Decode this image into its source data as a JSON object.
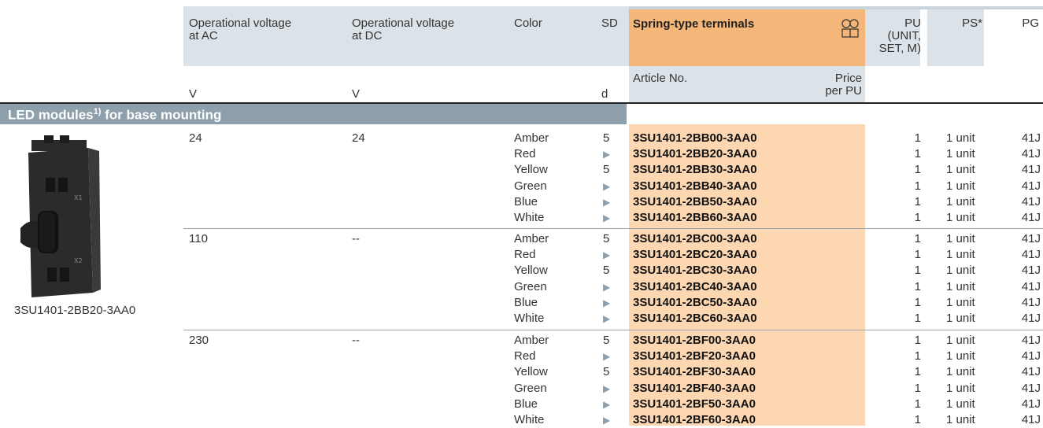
{
  "header": {
    "col_ac": [
      "Operational voltage",
      "at AC"
    ],
    "col_dc": [
      "Operational voltage",
      "at DC"
    ],
    "col_color": "Color",
    "col_sd": "SD",
    "col_terminals": "Spring-type terminals",
    "col_pu": [
      "PU",
      "(UNIT,",
      "SET, M)"
    ],
    "col_ps": "PS*",
    "col_pg": "PG",
    "unit_ac": "V",
    "unit_dc": "V",
    "unit_sd": "d",
    "col_article": "Article No.",
    "col_price": [
      "Price",
      "per PU"
    ]
  },
  "section": {
    "title": "LED modules",
    "sup": "1)",
    "title_suffix": " for base mounting"
  },
  "product": {
    "caption": "3SU1401-2BB20-3AA0",
    "mark_x1": "X1",
    "mark_x2": "X2"
  },
  "groups": [
    {
      "ac": "24",
      "dc": "24",
      "rows": [
        {
          "color": "Amber",
          "sd": "5",
          "article": "3SU1401-2BB00-3AA0",
          "pu": "1",
          "ps": "1 unit",
          "pg": "41J"
        },
        {
          "color": "Red",
          "sd": "▶",
          "article": "3SU1401-2BB20-3AA0",
          "pu": "1",
          "ps": "1 unit",
          "pg": "41J"
        },
        {
          "color": "Yellow",
          "sd": "5",
          "article": "3SU1401-2BB30-3AA0",
          "pu": "1",
          "ps": "1 unit",
          "pg": "41J"
        },
        {
          "color": "Green",
          "sd": "▶",
          "article": "3SU1401-2BB40-3AA0",
          "pu": "1",
          "ps": "1 unit",
          "pg": "41J"
        },
        {
          "color": "Blue",
          "sd": "▶",
          "article": "3SU1401-2BB50-3AA0",
          "pu": "1",
          "ps": "1 unit",
          "pg": "41J"
        },
        {
          "color": "White",
          "sd": "▶",
          "article": "3SU1401-2BB60-3AA0",
          "pu": "1",
          "ps": "1 unit",
          "pg": "41J"
        }
      ]
    },
    {
      "ac": "110",
      "dc": "--",
      "rows": [
        {
          "color": "Amber",
          "sd": "5",
          "article": "3SU1401-2BC00-3AA0",
          "pu": "1",
          "ps": "1 unit",
          "pg": "41J"
        },
        {
          "color": "Red",
          "sd": "▶",
          "article": "3SU1401-2BC20-3AA0",
          "pu": "1",
          "ps": "1 unit",
          "pg": "41J"
        },
        {
          "color": "Yellow",
          "sd": "5",
          "article": "3SU1401-2BC30-3AA0",
          "pu": "1",
          "ps": "1 unit",
          "pg": "41J"
        },
        {
          "color": "Green",
          "sd": "▶",
          "article": "3SU1401-2BC40-3AA0",
          "pu": "1",
          "ps": "1 unit",
          "pg": "41J"
        },
        {
          "color": "Blue",
          "sd": "▶",
          "article": "3SU1401-2BC50-3AA0",
          "pu": "1",
          "ps": "1 unit",
          "pg": "41J"
        },
        {
          "color": "White",
          "sd": "▶",
          "article": "3SU1401-2BC60-3AA0",
          "pu": "1",
          "ps": "1 unit",
          "pg": "41J"
        }
      ]
    },
    {
      "ac": "230",
      "dc": "--",
      "rows": [
        {
          "color": "Amber",
          "sd": "5",
          "article": "3SU1401-2BF00-3AA0",
          "pu": "1",
          "ps": "1 unit",
          "pg": "41J"
        },
        {
          "color": "Red",
          "sd": "▶",
          "article": "3SU1401-2BF20-3AA0",
          "pu": "1",
          "ps": "1 unit",
          "pg": "41J"
        },
        {
          "color": "Yellow",
          "sd": "5",
          "article": "3SU1401-2BF30-3AA0",
          "pu": "1",
          "ps": "1 unit",
          "pg": "41J"
        },
        {
          "color": "Green",
          "sd": "▶",
          "article": "3SU1401-2BF40-3AA0",
          "pu": "1",
          "ps": "1 unit",
          "pg": "41J"
        },
        {
          "color": "Blue",
          "sd": "▶",
          "article": "3SU1401-2BF50-3AA0",
          "pu": "1",
          "ps": "1 unit",
          "pg": "41J"
        },
        {
          "color": "White",
          "sd": "▶",
          "article": "3SU1401-2BF60-3AA0",
          "pu": "1",
          "ps": "1 unit",
          "pg": "41J"
        }
      ]
    }
  ],
  "colors": {
    "header_gray": "#dce3e8",
    "header_orange": "#f5b679",
    "col_orange": "#fdd7b2",
    "section_bar": "#8ea0ab"
  },
  "icons": {
    "terminal": "spring-terminal-icon"
  }
}
